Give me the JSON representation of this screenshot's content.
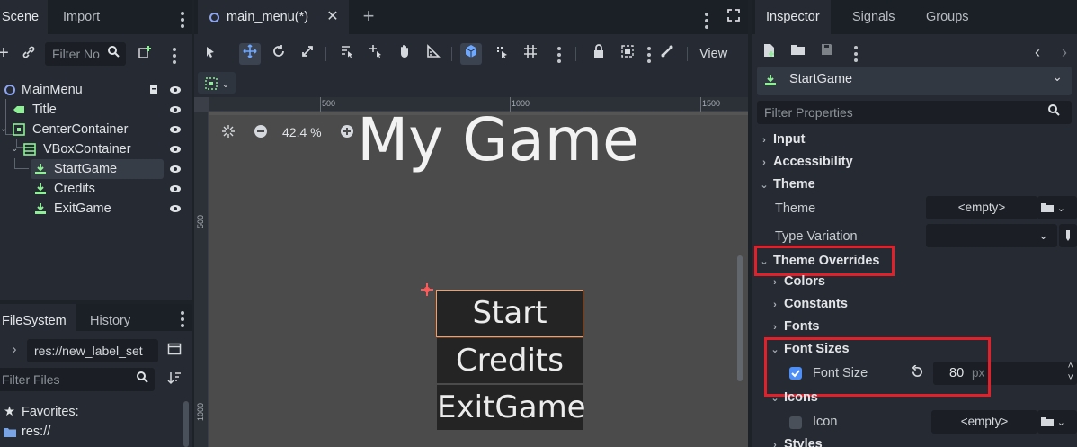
{
  "scene_dock": {
    "tabs": [
      {
        "label": "Scene"
      },
      {
        "label": "Import"
      }
    ],
    "filter_placeholder": "Filter No",
    "nodes": [
      {
        "label": "MainMenu",
        "type": "control"
      },
      {
        "label": "Title",
        "type": "label"
      },
      {
        "label": "CenterContainer",
        "type": "center-container"
      },
      {
        "label": "VBoxContainer",
        "type": "vbox-container"
      },
      {
        "label": "StartGame",
        "type": "button"
      },
      {
        "label": "Credits",
        "type": "button"
      },
      {
        "label": "ExitGame",
        "type": "button"
      }
    ]
  },
  "filesystem_dock": {
    "tabs": [
      {
        "label": "FileSystem"
      },
      {
        "label": "History"
      }
    ],
    "path": "res://new_label_set",
    "filter_placeholder": "Filter Files",
    "favorites_label": "Favorites:",
    "res_label": "res://"
  },
  "editor": {
    "tab_label": "main_menu(*)",
    "view_label": "View",
    "zoom": "42.4 %",
    "ruler_ticks_h": [
      "500",
      "1000",
      "1500"
    ],
    "ruler_ticks_v": [
      "500",
      "1000"
    ],
    "game_title": "My Game",
    "buttons": [
      {
        "label": "Start"
      },
      {
        "label": "Credits"
      },
      {
        "label": "ExitGame"
      }
    ]
  },
  "inspector": {
    "tabs": [
      {
        "label": "Inspector"
      },
      {
        "label": "Signals"
      },
      {
        "label": "Groups"
      }
    ],
    "node_name": "StartGame",
    "filter_placeholder": "Filter Properties",
    "sections": {
      "input": "Input",
      "accessibility": "Accessibility",
      "theme": "Theme",
      "theme_prop": "Theme",
      "theme_value": "<empty>",
      "type_variation": "Type Variation",
      "theme_overrides": "Theme Overrides",
      "colors": "Colors",
      "constants": "Constants",
      "fonts": "Fonts",
      "font_sizes": "Font Sizes",
      "font_size": "Font Size",
      "font_size_value": "80",
      "font_size_unit": "px",
      "icons": "Icons",
      "icon": "Icon",
      "icon_value": "<empty>",
      "styles": "Styles"
    },
    "font_size_checked": true
  },
  "colors": {
    "accent": "#4e8ef7",
    "highlight": "#e0202a",
    "node_green": "#8eef97",
    "selection_outline": "#ff9a5c"
  }
}
